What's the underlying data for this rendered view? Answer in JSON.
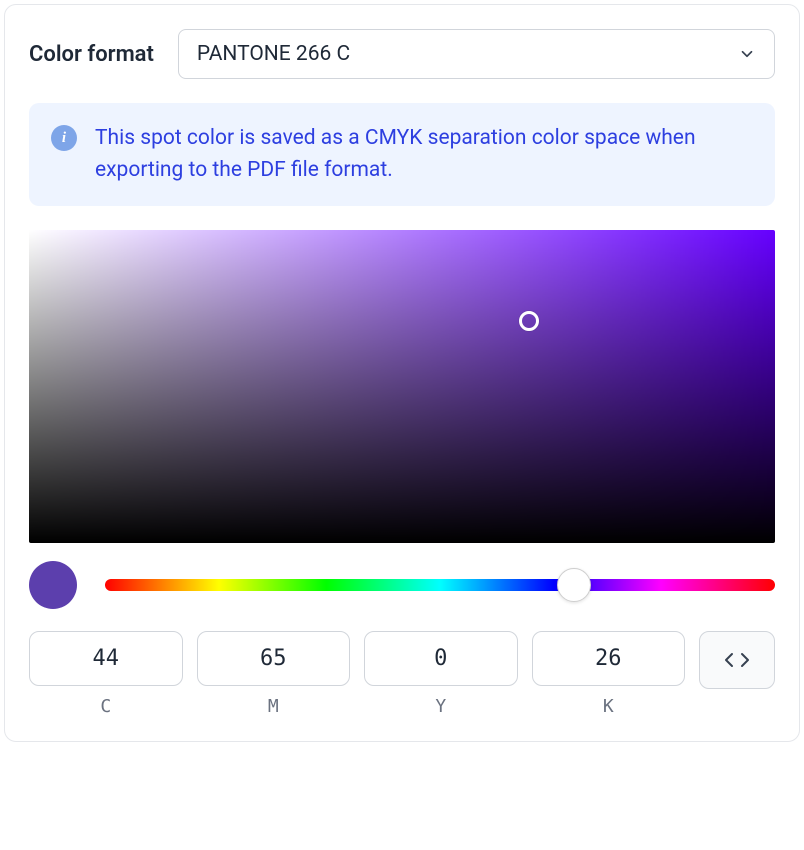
{
  "format": {
    "label": "Color format",
    "selected": "PANTONE 266 C"
  },
  "info": {
    "message": "This spot color is saved as a CMYK separation color space when exporting to the PDF file format."
  },
  "swatch": {
    "hex": "#5c3fad"
  },
  "cmyk": {
    "c": {
      "value": "44",
      "label": "C"
    },
    "m": {
      "value": "65",
      "label": "M"
    },
    "y": {
      "value": "0",
      "label": "Y"
    },
    "k": {
      "value": "26",
      "label": "K"
    }
  }
}
